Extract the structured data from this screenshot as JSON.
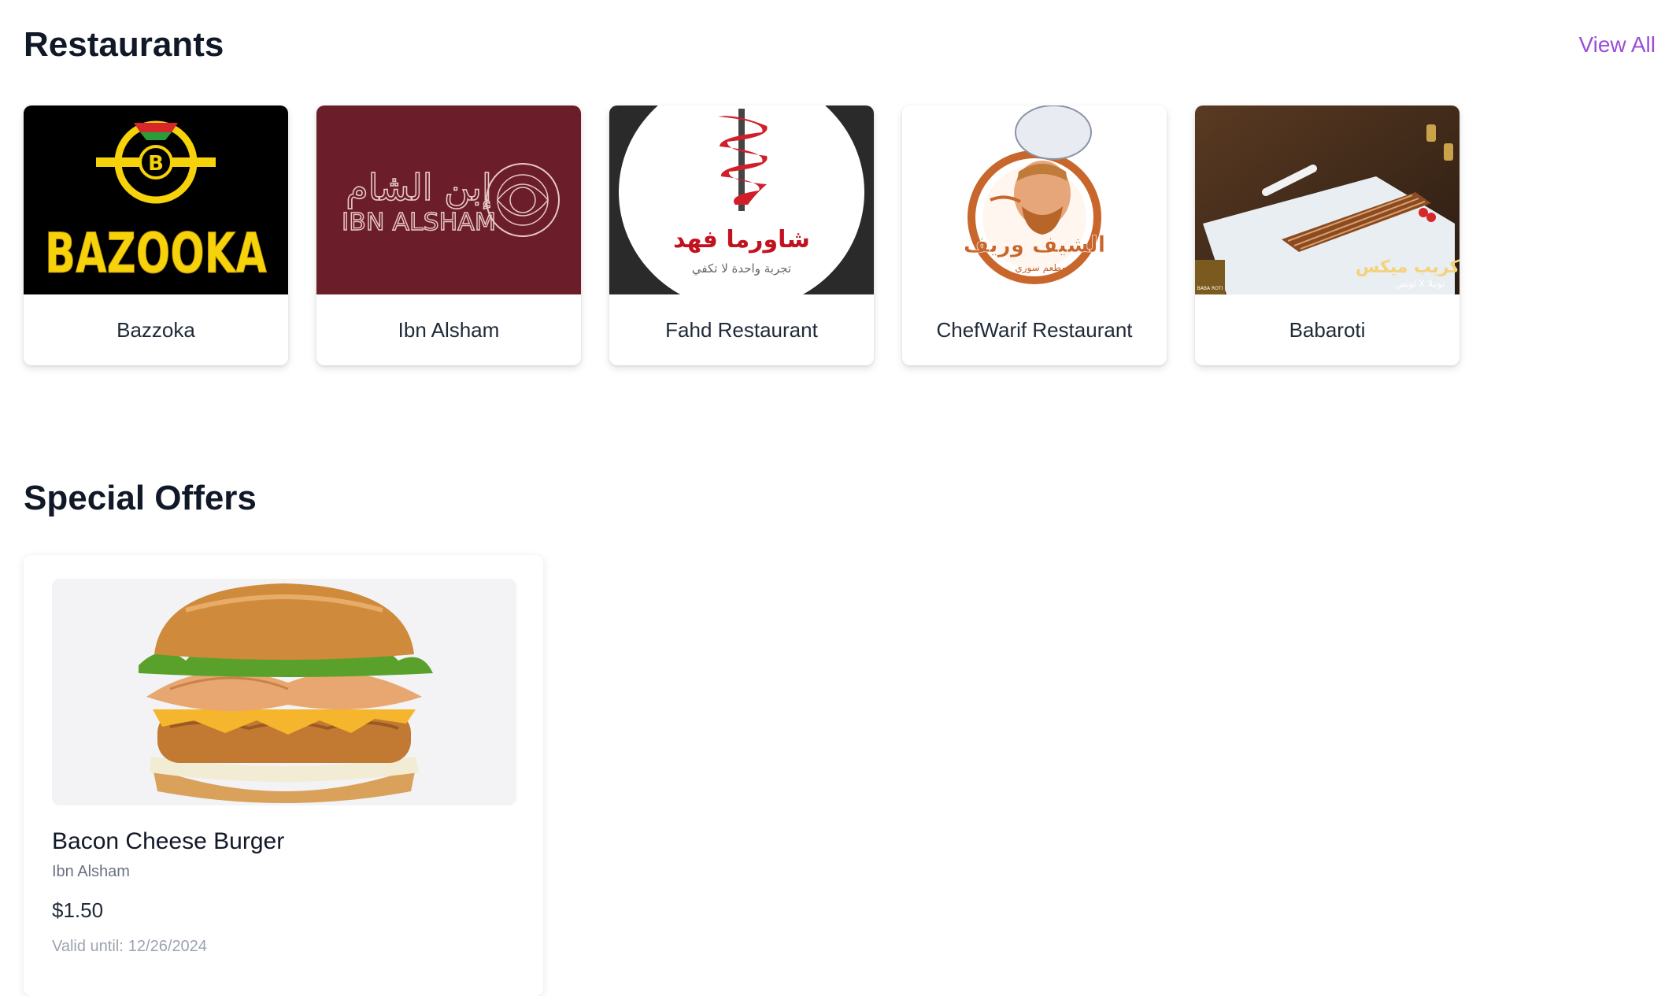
{
  "restaurants_section": {
    "title": "Restaurants",
    "view_all_label": "View All",
    "items": [
      {
        "name": "Bazzoka",
        "logo_text": "BAZOOKA",
        "logo_mark": "B"
      },
      {
        "name": "Ibn Alsham",
        "logo_text": "IBN ALSHAM",
        "logo_arabic": "إبن الشام"
      },
      {
        "name": "Fahd Restaurant",
        "logo_arabic": "شاورما فهد",
        "logo_tagline": "تجربة واحدة لا تكفي"
      },
      {
        "name": "ChefWarif Restaurant",
        "logo_arabic": "الشيف وريف",
        "logo_tagline": "مطعم سوري"
      },
      {
        "name": "Babaroti",
        "logo_arabic": "كريب ميكس",
        "logo_tagline": "لوتس X نوتيلا",
        "logo_brand": "BABA ROTI"
      }
    ]
  },
  "offers_section": {
    "title": "Special Offers",
    "offers": [
      {
        "name": "Bacon Cheese Burger",
        "restaurant": "Ibn Alsham",
        "price": "$1.50",
        "valid_label": "Valid until:",
        "valid_date": "12/26/2024"
      }
    ]
  },
  "colors": {
    "accent": "#9b4dd9",
    "ibn_alsham_bg": "#6b1e29",
    "bazooka_yellow": "#f5d20a",
    "chefwarif_orange": "#c8662b"
  }
}
